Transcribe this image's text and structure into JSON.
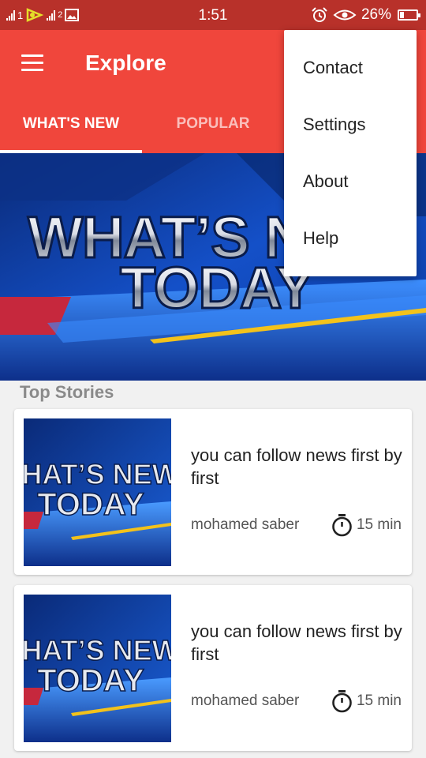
{
  "status_bar": {
    "sim1": "1",
    "sim2": "2",
    "time": "1:51",
    "battery": "26%"
  },
  "app_bar": {
    "title": "Explore",
    "tabs": [
      {
        "label": "WHAT'S NEW",
        "active": true
      },
      {
        "label": "POPULAR",
        "active": false
      }
    ]
  },
  "hero": {
    "line1": "WHAT’S NEW",
    "line2": "TODAY"
  },
  "section": {
    "title": "Top Stories"
  },
  "stories": [
    {
      "title": "you can follow news first by first",
      "author": "mohamed saber",
      "time": "15 min",
      "thumb_line1": "WHAT’S NEW",
      "thumb_line2": "TODAY"
    },
    {
      "title": "you can follow news first by first",
      "author": "mohamed saber",
      "time": "15 min",
      "thumb_line1": "WHAT’S NEW",
      "thumb_line2": "TODAY"
    }
  ],
  "menu": {
    "items": [
      "Contact",
      "Settings",
      "About",
      "Help"
    ]
  },
  "colors": {
    "status_bar": "#b8312a",
    "app_bar": "#f0463c",
    "background": "#f1f1f1"
  },
  "icons": {
    "menu": "hamburger-icon",
    "timer": "stopwatch-icon",
    "alarm": "alarm-icon",
    "eye": "eye-icon",
    "battery": "battery-icon",
    "gallery": "image-icon"
  }
}
